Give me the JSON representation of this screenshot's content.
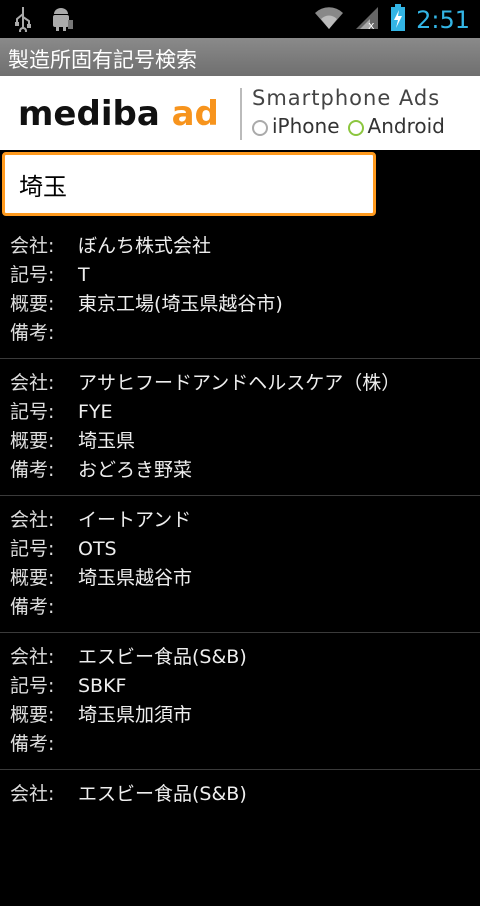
{
  "status_bar": {
    "time": "2:51",
    "icons": [
      "usb-icon",
      "android-debug-icon",
      "wifi-icon",
      "signal-icon",
      "battery-charging-icon"
    ]
  },
  "app": {
    "title": "製造所固有記号検索"
  },
  "ad": {
    "logo_main": "mediba",
    "logo_accent": "ad",
    "tagline": "Smartphone Ads",
    "platforms": [
      "iPhone",
      "Android"
    ]
  },
  "search": {
    "value": "埼玉",
    "placeholder": ""
  },
  "labels": {
    "company": "会社:",
    "code": "記号:",
    "summary": "概要:",
    "notes": "備考:"
  },
  "results": [
    {
      "company": "ぼんち株式会社",
      "code": "T",
      "summary": "東京工場(埼玉県越谷市)",
      "notes": ""
    },
    {
      "company": "アサヒフードアンドヘルスケア（株）",
      "code": "FYE",
      "summary": "埼玉県",
      "notes": "おどろき野菜"
    },
    {
      "company": "イートアンド",
      "code": "OTS",
      "summary": "埼玉県越谷市",
      "notes": ""
    },
    {
      "company": "エスビー食品(S&B)",
      "code": "SBKF",
      "summary": "埼玉県加須市",
      "notes": ""
    },
    {
      "company": "エスビー食品(S&B)",
      "code": "",
      "summary": "",
      "notes": ""
    }
  ]
}
